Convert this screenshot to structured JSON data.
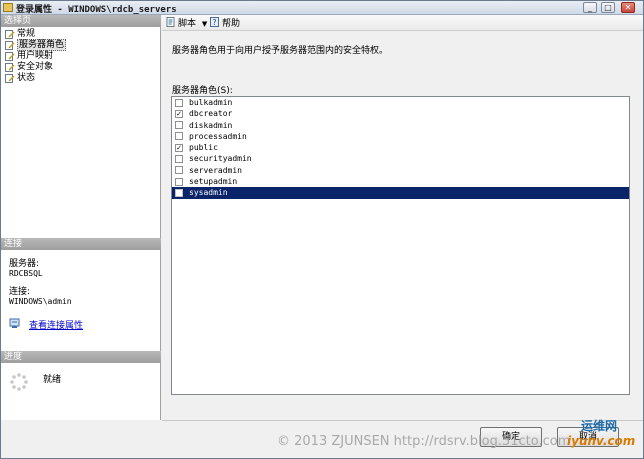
{
  "window": {
    "title": "登录属性 - WINDOWS\\rdcb_servers",
    "buttons": [
      "_",
      "□",
      "✕"
    ]
  },
  "left": {
    "select_page_header": "选择页",
    "pages": [
      {
        "label": "常规",
        "icon": "page-icon"
      },
      {
        "label": "服务器角色",
        "icon": "page-icon",
        "selected": true
      },
      {
        "label": "用户映射",
        "icon": "page-icon"
      },
      {
        "label": "安全对象",
        "icon": "page-icon"
      },
      {
        "label": "状态",
        "icon": "page-icon"
      }
    ],
    "connection_header": "连接",
    "server_label": "服务器:",
    "server_value": "RDCBSQL",
    "connection_label": "连接:",
    "connection_value": "WINDOWS\\admin",
    "view_connection_link": "查看连接属性",
    "progress_header": "进度",
    "progress_status": "就绪"
  },
  "toolbar": {
    "script_label": "脚本",
    "help_label": "帮助"
  },
  "main": {
    "description": "服务器角色用于向用户授予服务器范围内的安全特权。",
    "roles_label": "服务器角色(S):",
    "roles": [
      {
        "name": "bulkadmin",
        "checked": false,
        "selected": false
      },
      {
        "name": "dbcreator",
        "checked": true,
        "selected": false
      },
      {
        "name": "diskadmin",
        "checked": false,
        "selected": false
      },
      {
        "name": "processadmin",
        "checked": false,
        "selected": false
      },
      {
        "name": "public",
        "checked": true,
        "selected": false
      },
      {
        "name": "securityadmin",
        "checked": false,
        "selected": false
      },
      {
        "name": "serveradmin",
        "checked": false,
        "selected": false
      },
      {
        "name": "setupadmin",
        "checked": false,
        "selected": false
      },
      {
        "name": "sysadmin",
        "checked": false,
        "selected": true
      }
    ]
  },
  "footer": {
    "ok_label": "确定",
    "cancel_label": "取消"
  },
  "watermark": {
    "text": "© 2013 ZJUNSEN http://rdsrv.blog.51cto.com",
    "logo_top": "运维网",
    "logo_bottom": "iyunv.com"
  },
  "colors": {
    "selection": "#0a246a",
    "section_header": "#a8a8a8",
    "link": "#0000cc"
  }
}
